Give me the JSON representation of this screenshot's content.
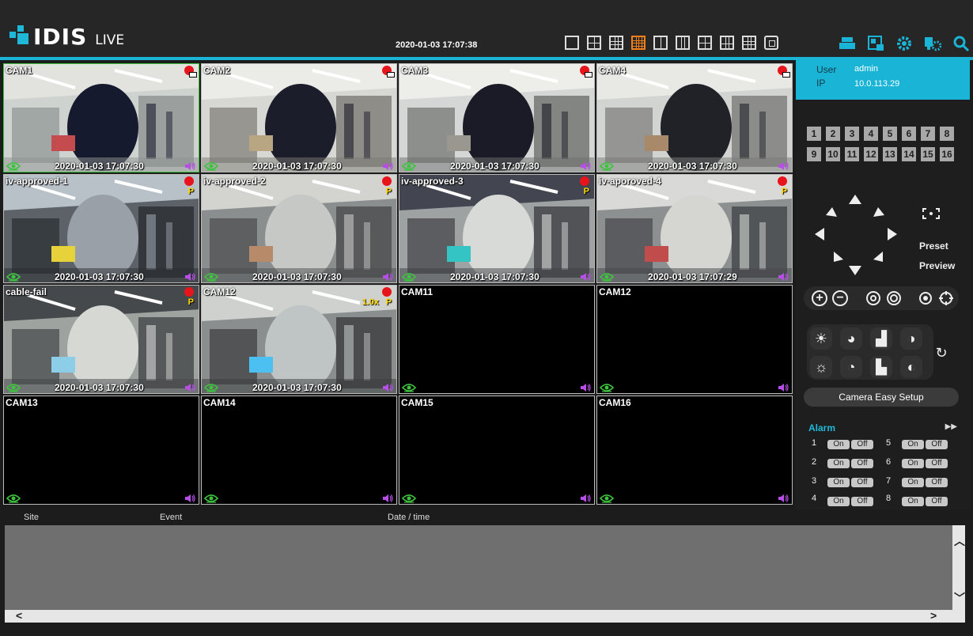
{
  "app": {
    "brand": "IDIS",
    "mode": "LIVE",
    "datetime": "2020-01-03 17:07:38",
    "accent": "#19b4d6",
    "active_layout_color": "#f0801c"
  },
  "toolbar": {
    "layouts": [
      "layout-1x1-icon",
      "layout-2x2-icon",
      "layout-3x3-icon",
      "layout-4x4-icon",
      "layout-1plus-icon",
      "layout-1x3-icon",
      "layout-1plus5-icon",
      "layout-1plus7-icon",
      "layout-custom-icon",
      "fullscreen-icon"
    ],
    "active_layout": 3,
    "tools": [
      "printer-icon",
      "export-icon",
      "gear-icon",
      "network-setup-icon",
      "search-icon"
    ]
  },
  "cameras": [
    {
      "name": "CAM1",
      "time": "2020-01-03 17:07:30",
      "rec": true,
      "ptz": false,
      "zoom": "",
      "active": true,
      "feed": true
    },
    {
      "name": "CAM2",
      "time": "2020-01-03 17:07:30",
      "rec": true,
      "ptz": false,
      "zoom": "",
      "active": false,
      "feed": true
    },
    {
      "name": "CAM3",
      "time": "2020-01-03 17:07:30",
      "rec": true,
      "ptz": false,
      "zoom": "",
      "active": false,
      "feed": true
    },
    {
      "name": "CAM4",
      "time": "2020-01-03 17:07:30",
      "rec": true,
      "ptz": false,
      "zoom": "",
      "active": false,
      "feed": true
    },
    {
      "name": "iv-approved-1",
      "time": "2020-01-03 17:07:30",
      "rec": true,
      "ptz": true,
      "zoom": "",
      "active": false,
      "feed": true
    },
    {
      "name": "iv-approved-2",
      "time": "2020-01-03 17:07:30",
      "rec": true,
      "ptz": true,
      "zoom": "",
      "active": false,
      "feed": true
    },
    {
      "name": "iv-approved-3",
      "time": "2020-01-03 17:07:30",
      "rec": true,
      "ptz": true,
      "zoom": "",
      "active": false,
      "feed": true
    },
    {
      "name": "iv-aporoved-4",
      "time": "2020-01-03 17:07:29",
      "rec": true,
      "ptz": true,
      "zoom": "",
      "active": false,
      "feed": true
    },
    {
      "name": "cable-fail",
      "time": "2020-01-03 17:07:30",
      "rec": true,
      "ptz": true,
      "zoom": "",
      "active": false,
      "feed": true
    },
    {
      "name": "CAM12",
      "time": "2020-01-03 17:07:30",
      "rec": true,
      "ptz": true,
      "zoom": "1.0x",
      "active": false,
      "feed": true
    },
    {
      "name": "CAM11",
      "time": "",
      "rec": false,
      "ptz": false,
      "zoom": "",
      "active": false,
      "feed": false
    },
    {
      "name": "CAM12",
      "time": "",
      "rec": false,
      "ptz": false,
      "zoom": "",
      "active": false,
      "feed": false
    },
    {
      "name": "CAM13",
      "time": "",
      "rec": false,
      "ptz": false,
      "zoom": "",
      "active": false,
      "feed": false
    },
    {
      "name": "CAM14",
      "time": "",
      "rec": false,
      "ptz": false,
      "zoom": "",
      "active": false,
      "feed": false
    },
    {
      "name": "CAM15",
      "time": "",
      "rec": false,
      "ptz": false,
      "zoom": "",
      "active": false,
      "feed": false
    },
    {
      "name": "CAM16",
      "time": "",
      "rec": false,
      "ptz": false,
      "zoom": "",
      "active": false,
      "feed": false
    }
  ],
  "panel": {
    "user_label": "User",
    "user_value": "admin",
    "ip_label": "IP",
    "ip_value": "10.0.113.29",
    "channels": [
      "1",
      "2",
      "3",
      "4",
      "5",
      "6",
      "7",
      "8",
      "9",
      "10",
      "11",
      "12",
      "13",
      "14",
      "15",
      "16"
    ],
    "preset_label": "Preset",
    "preview_label": "Preview",
    "easy_setup_label": "Camera Easy Setup",
    "alarm_title": "Alarm",
    "alarm_on": "On",
    "alarm_off": "Off",
    "alarms": [
      "1",
      "2",
      "3",
      "4",
      "5",
      "6",
      "7",
      "8"
    ]
  },
  "events": {
    "columns": [
      "Site",
      "Event",
      "Date / time"
    ]
  }
}
